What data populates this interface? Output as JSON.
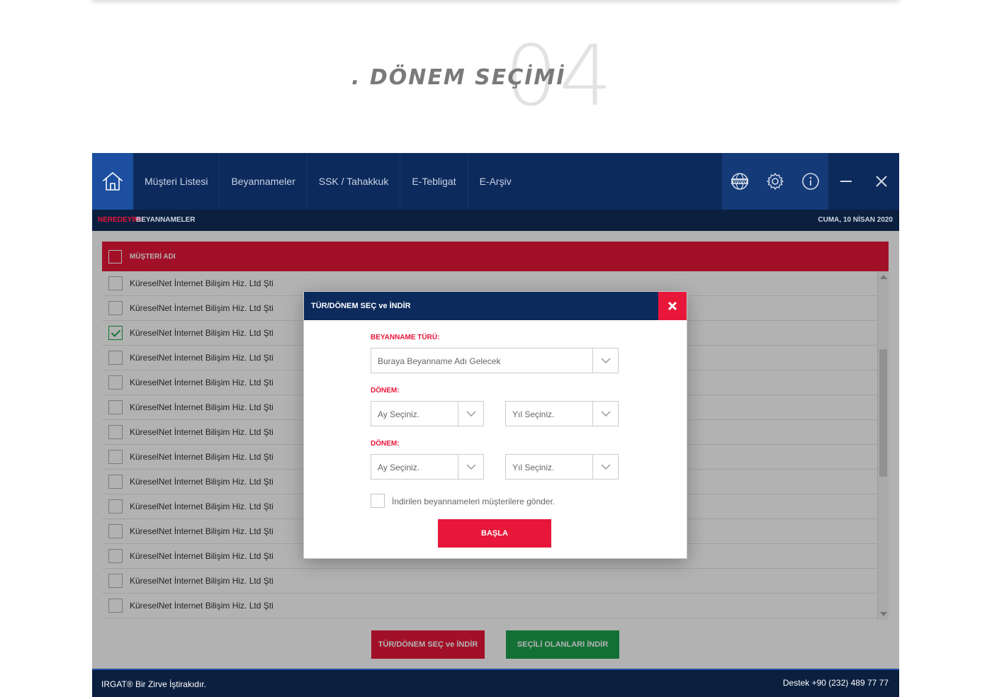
{
  "hero": {
    "number": "04",
    "title": ". DÖNEM SEÇİMİ"
  },
  "navbar": {
    "items": [
      "Müşteri Listesi",
      "Beyannameler",
      "SSK / Tahakkuk",
      "E-Tebligat",
      "E-Arşiv"
    ],
    "icons": [
      "home-icon",
      "globe-www-icon",
      "gear-icon",
      "info-icon",
      "minimize-icon",
      "close-icon"
    ]
  },
  "breadcrumb": {
    "label": "NEREDEYİM:",
    "value": "BEYANNAMELER",
    "date": "CUMA, 10 NİSAN 2020"
  },
  "table": {
    "header": "MÜŞTERİ ADI",
    "rows": [
      {
        "name": "KüreselNet İnternet Bilişim Hiz. Ltd Şti",
        "checked": false
      },
      {
        "name": "KüreselNet İnternet Bilişim Hiz. Ltd Şti",
        "checked": false
      },
      {
        "name": "KüreselNet İnternet Bilişim Hiz. Ltd Şti",
        "checked": true
      },
      {
        "name": "KüreselNet İnternet Bilişim Hiz. Ltd Şti",
        "checked": false
      },
      {
        "name": "KüreselNet İnternet Bilişim Hiz. Ltd Şti",
        "checked": false
      },
      {
        "name": "KüreselNet İnternet Bilişim Hiz. Ltd Şti",
        "checked": false
      },
      {
        "name": "KüreselNet İnternet Bilişim Hiz. Ltd Şti",
        "checked": false
      },
      {
        "name": "KüreselNet İnternet Bilişim Hiz. Ltd Şti",
        "checked": false
      },
      {
        "name": "KüreselNet İnternet Bilişim Hiz. Ltd Şti",
        "checked": false
      },
      {
        "name": "KüreselNet İnternet Bilişim Hiz. Ltd Şti",
        "checked": false
      },
      {
        "name": "KüreselNet İnternet Bilişim Hiz. Ltd Şti",
        "checked": false
      },
      {
        "name": "KüreselNet İnternet Bilişim Hiz. Ltd Şti",
        "checked": false
      },
      {
        "name": "KüreselNet İnternet Bilişim Hiz. Ltd Şti",
        "checked": false
      },
      {
        "name": "KüreselNet İnternet Bilişim Hiz. Ltd Şti",
        "checked": false
      }
    ]
  },
  "actions": {
    "select_download": "TÜR/DÖNEM SEÇ ve İNDİR",
    "download_selected": "SEÇİLİ OLANLARI İNDİR"
  },
  "modal": {
    "title": "TÜR/DÖNEM SEÇ ve İNDİR",
    "type_label": "BEYANNAME TÜRÜ:",
    "type_placeholder": "Buraya Beyanname Adı Gelecek",
    "period_label_1": "DÖNEM:",
    "period_label_2": "DÖNEM:",
    "month_placeholder": "Ay Seçiniz.",
    "year_placeholder": "Yıl Seçiniz.",
    "send_label": "İndirilen beyannameleri müşterilere gönder.",
    "start": "BAŞLA"
  },
  "footer": {
    "left": "IRGAT® Bir Zirve İştirakıdır.",
    "right": "Destek +90 (232) 489 77 77"
  },
  "colors": {
    "navy": "#0c2a5c",
    "accent_red": "#e8173a",
    "green": "#1ca14b",
    "blue": "#1c4fa0"
  }
}
